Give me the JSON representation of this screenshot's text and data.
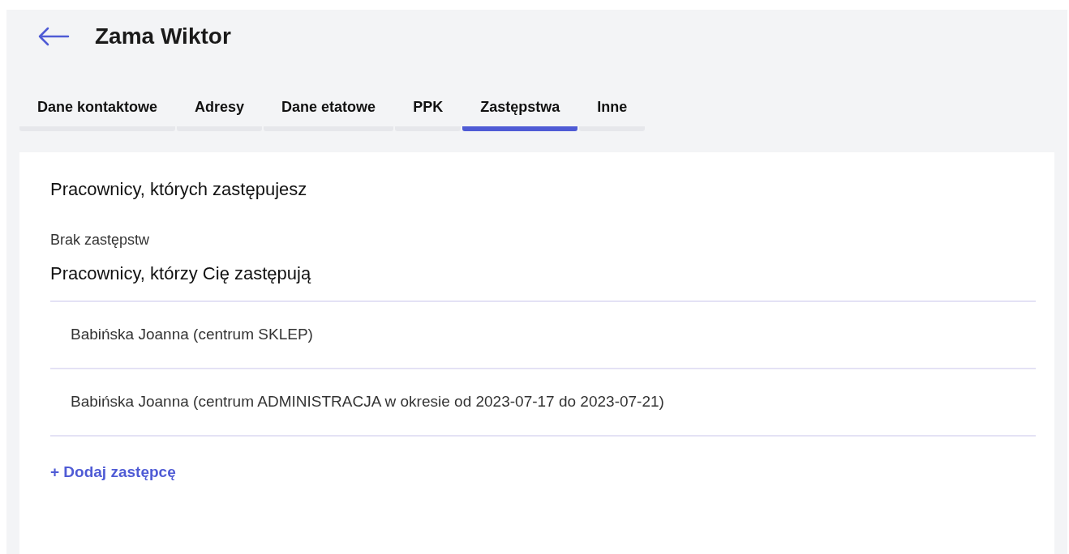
{
  "header": {
    "title": "Zama Wiktor"
  },
  "tabs": [
    {
      "label": "Dane kontaktowe",
      "selected": false
    },
    {
      "label": "Adresy",
      "selected": false
    },
    {
      "label": "Dane etatowe",
      "selected": false
    },
    {
      "label": "PPK",
      "selected": false
    },
    {
      "label": "Zastępstwa",
      "selected": true
    },
    {
      "label": "Inne",
      "selected": false
    }
  ],
  "sections": [
    {
      "heading": "Pracownicy, których zastępujesz",
      "empty_text": "Brak zastępstw"
    },
    {
      "heading": "Pracownicy, którzy Cię zastępują",
      "items": [
        "Babińska Joanna (centrum SKLEP)",
        "Babińska Joanna (centrum ADMINISTRACJA w okresie od 2023-07-17 do 2023-07-21)"
      ],
      "add_link": "+ Dodaj zastępcę"
    }
  ]
}
